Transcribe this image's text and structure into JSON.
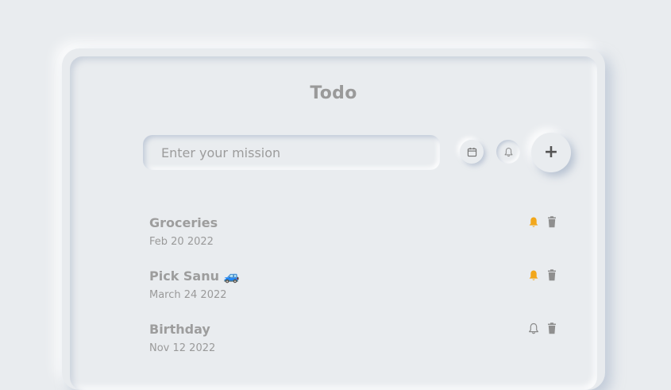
{
  "app": {
    "title": "Todo"
  },
  "form": {
    "placeholder": "Enter your mission",
    "add_label": "+"
  },
  "icons": {
    "calendar": "calendar-icon",
    "bell": "bell-icon",
    "add": "plus-icon",
    "delete": "trash-icon"
  },
  "colors": {
    "accent_bell": "#f2a71b",
    "muted": "#9a9a9a",
    "background": "#e9ecef"
  },
  "tasks": [
    {
      "title": "Groceries",
      "date": "Feb 20 2022",
      "reminder": true
    },
    {
      "title": "Pick Sanu 🚙",
      "date": "March 24 2022",
      "reminder": true
    },
    {
      "title": "Birthday",
      "date": "Nov 12 2022",
      "reminder": false
    }
  ]
}
